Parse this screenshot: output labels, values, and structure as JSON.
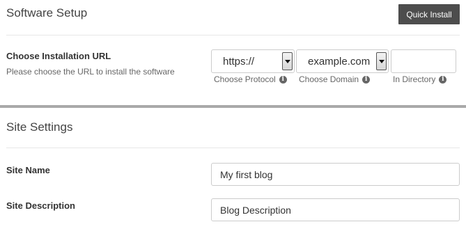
{
  "software_setup": {
    "title": "Software Setup",
    "quick_install_label": "Quick Install",
    "install_url": {
      "label": "Choose Installation URL",
      "description": "Please choose the URL to install the software",
      "protocol": {
        "value": "https://",
        "caption": "Choose Protocol"
      },
      "domain": {
        "value": "example.com",
        "caption": "Choose Domain"
      },
      "directory": {
        "value": "",
        "caption": "In Directory"
      }
    }
  },
  "site_settings": {
    "title": "Site Settings",
    "site_name": {
      "label": "Site Name",
      "value": "My first blog"
    },
    "site_description": {
      "label": "Site Description",
      "value": "Blog Description"
    }
  },
  "icons": {
    "info": "info-icon"
  },
  "colors": {
    "button_bg": "#4d4d4d",
    "divider_thick": "#a9a9a9"
  }
}
